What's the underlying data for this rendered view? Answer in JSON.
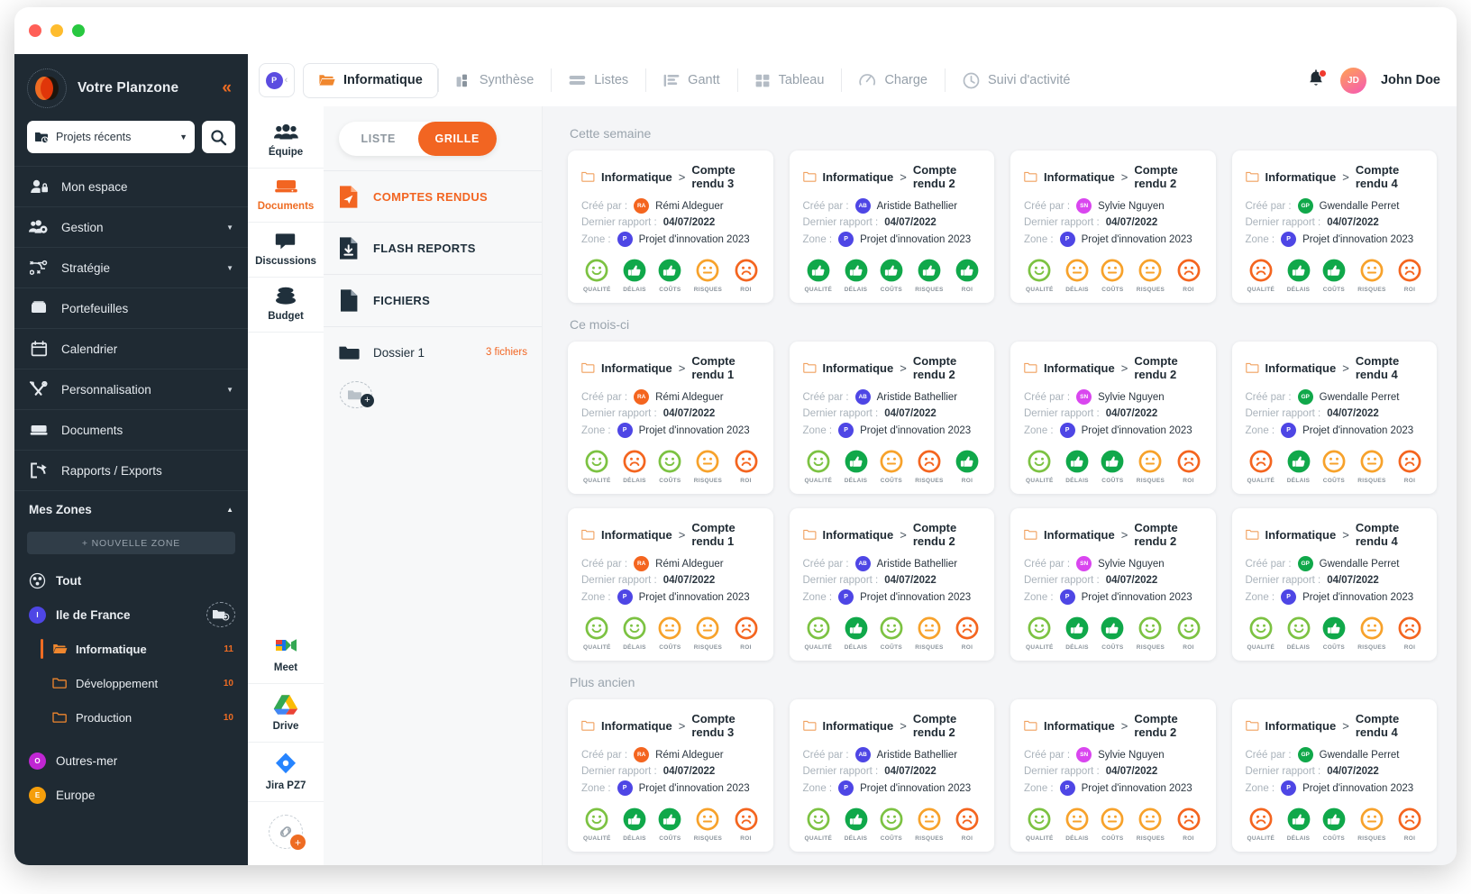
{
  "window": {
    "title": "Planzone"
  },
  "sidebar": {
    "brand": "Votre Planzone",
    "collapse_icon": "double-chevron-left-icon",
    "project_select": {
      "value": "Projets récents",
      "icon": "folder-clock-icon"
    },
    "search_icon": "search-icon",
    "nav": [
      {
        "label": "Mon espace",
        "icon": "user-lock-icon",
        "expandable": false
      },
      {
        "label": "Gestion",
        "icon": "users-gear-icon",
        "expandable": true
      },
      {
        "label": "Stratégie",
        "icon": "strategy-icon",
        "expandable": true
      },
      {
        "label": "Portefeuilles",
        "icon": "portfolio-icon",
        "expandable": false
      },
      {
        "label": "Calendrier",
        "icon": "calendar-icon",
        "expandable": false
      },
      {
        "label": "Personnalisation",
        "icon": "tools-icon",
        "expandable": true
      },
      {
        "label": "Documents",
        "icon": "documents-icon",
        "expandable": false
      },
      {
        "label": "Rapports / Exports",
        "icon": "export-icon",
        "expandable": false
      }
    ],
    "zones_header": "Mes Zones",
    "new_zone_label": "+ NOUVELLE ZONE",
    "zones": [
      {
        "label": "Tout",
        "badge": "",
        "badge_color": "",
        "icon": "all-zones-icon",
        "type": "all"
      },
      {
        "label": "Ile de France",
        "badge": "I",
        "badge_color": "#4e46e5",
        "type": "zone",
        "has_add": true
      },
      {
        "label": "Informatique",
        "count": "11",
        "type": "sub",
        "active": true
      },
      {
        "label": "Développement",
        "count": "10",
        "type": "sub",
        "active": false
      },
      {
        "label": "Production",
        "count": "10",
        "type": "sub",
        "active": false
      },
      {
        "label": "Outres-mer",
        "badge": "O",
        "badge_color": "#c026d3",
        "type": "zone"
      },
      {
        "label": "Europe",
        "badge": "E",
        "badge_color": "#f59e0b",
        "type": "zone"
      }
    ]
  },
  "topbar": {
    "project_badge": "P",
    "active_tab": {
      "label": "Informatique",
      "icon": "folder-open-icon"
    },
    "tabs": [
      {
        "label": "Synthèse",
        "icon": "synthesis-icon"
      },
      {
        "label": "Listes",
        "icon": "lists-icon"
      },
      {
        "label": "Gantt",
        "icon": "gantt-icon"
      },
      {
        "label": "Tableau",
        "icon": "board-icon"
      },
      {
        "label": "Charge",
        "icon": "gauge-icon"
      },
      {
        "label": "Suivi d'activité",
        "icon": "clock-icon"
      }
    ],
    "notification_icon": "bell-icon",
    "user": {
      "initials": "JD",
      "name": "John Doe"
    }
  },
  "rail": {
    "items": [
      {
        "label": "Équipe",
        "icon": "team-icon",
        "active": false
      },
      {
        "label": "Documents",
        "icon": "documents-box-icon",
        "active": true
      },
      {
        "label": "Discussions",
        "icon": "chat-icon",
        "active": false
      },
      {
        "label": "Budget",
        "icon": "coins-icon",
        "active": false
      }
    ],
    "apps": [
      {
        "label": "Meet",
        "icon": "google-meet-icon"
      },
      {
        "label": "Drive",
        "icon": "google-drive-icon"
      },
      {
        "label": "Jira PZ7",
        "icon": "jira-icon"
      }
    ],
    "add_link_icon": "link-add-icon"
  },
  "docpanel": {
    "view_toggle": {
      "list_label": "LISTE",
      "grid_label": "GRILLE",
      "selected": "GRILLE"
    },
    "items": [
      {
        "label": "COMPTES RENDUS",
        "icon": "report-send-icon",
        "active": true
      },
      {
        "label": "FLASH REPORTS",
        "icon": "report-download-icon",
        "active": false
      },
      {
        "label": "FICHIERS",
        "icon": "file-icon",
        "active": false
      }
    ],
    "folders": [
      {
        "label": "Dossier 1",
        "count": "3 fichiers",
        "icon": "folder-icon"
      }
    ],
    "add_folder_icon": "folder-add-icon"
  },
  "kpi_labels": [
    "QUALITÉ",
    "DÉLAIS",
    "COÛTS",
    "RISQUES",
    "ROI"
  ],
  "kpi_colors": {
    "green_light": "#7cc242",
    "green": "#10a84a",
    "orange": "#f7a22b",
    "red": "#f4651f"
  },
  "card_labels": {
    "created_by": "Créé par :",
    "last_report": "Dernier rapport :",
    "zone": "Zone :"
  },
  "people": {
    "remi": {
      "name": "Rémi Aldeguer",
      "initials": "RA",
      "color": "#f4651f"
    },
    "aristide": {
      "name": "Aristide Bathellier",
      "initials": "AB",
      "color": "#4e46e5"
    },
    "sylvie": {
      "name": "Sylvie Nguyen",
      "initials": "SN",
      "color": "#d946ef"
    },
    "gwendalle": {
      "name": "Gwendalle Perret",
      "initials": "GP",
      "color": "#10a84a"
    }
  },
  "sections": [
    {
      "title": "Cette semaine",
      "cards": [
        {
          "breadcrumb": "Informatique",
          "title": "Compte rendu 3",
          "author": "remi",
          "date": "04/07/2022",
          "zone_badge": "P",
          "zone": "Projet d'innovation 2023",
          "kpis": [
            "smile-light",
            "thumb-up",
            "thumb-up",
            "neutral-orange",
            "sad-red"
          ]
        },
        {
          "breadcrumb": "Informatique",
          "title": "Compte rendu 2",
          "author": "aristide",
          "date": "04/07/2022",
          "zone_badge": "P",
          "zone": "Projet d'innovation 2023",
          "kpis": [
            "thumb-up",
            "thumb-up",
            "thumb-up",
            "thumb-up",
            "thumb-up"
          ]
        },
        {
          "breadcrumb": "Informatique",
          "title": "Compte rendu 2",
          "author": "sylvie",
          "date": "04/07/2022",
          "zone_badge": "P",
          "zone": "Projet d'innovation 2023",
          "kpis": [
            "smile-light",
            "neutral-orange",
            "neutral-orange",
            "neutral-orange",
            "sad-red"
          ]
        },
        {
          "breadcrumb": "Informatique",
          "title": "Compte rendu 4",
          "author": "gwendalle",
          "date": "04/07/2022",
          "zone_badge": "P",
          "zone": "Projet d'innovation 2023",
          "kpis": [
            "sad-red",
            "thumb-up",
            "thumb-up",
            "neutral-orange",
            "sad-red"
          ]
        }
      ]
    },
    {
      "title": "Ce mois-ci",
      "cards": [
        {
          "breadcrumb": "Informatique",
          "title": "Compte rendu 1",
          "author": "remi",
          "date": "04/07/2022",
          "zone_badge": "P",
          "zone": "Projet d'innovation 2023",
          "kpis": [
            "smile-light",
            "sad-red",
            "smile-light",
            "neutral-orange",
            "sad-red"
          ]
        },
        {
          "breadcrumb": "Informatique",
          "title": "Compte rendu 2",
          "author": "aristide",
          "date": "04/07/2022",
          "zone_badge": "P",
          "zone": "Projet d'innovation 2023",
          "kpis": [
            "smile-light",
            "thumb-up",
            "neutral-orange",
            "sad-red",
            "thumb-up"
          ]
        },
        {
          "breadcrumb": "Informatique",
          "title": "Compte rendu 2",
          "author": "sylvie",
          "date": "04/07/2022",
          "zone_badge": "P",
          "zone": "Projet d'innovation 2023",
          "kpis": [
            "smile-light",
            "thumb-up",
            "thumb-up",
            "neutral-orange",
            "sad-red"
          ]
        },
        {
          "breadcrumb": "Informatique",
          "title": "Compte rendu 4",
          "author": "gwendalle",
          "date": "04/07/2022",
          "zone_badge": "P",
          "zone": "Projet d'innovation 2023",
          "kpis": [
            "sad-red",
            "thumb-up",
            "neutral-orange",
            "neutral-orange",
            "sad-red"
          ]
        }
      ]
    },
    {
      "title": "",
      "cards": [
        {
          "breadcrumb": "Informatique",
          "title": "Compte rendu 1",
          "author": "remi",
          "date": "04/07/2022",
          "zone_badge": "P",
          "zone": "Projet d'innovation 2023",
          "kpis": [
            "smile-light",
            "smile-light",
            "neutral-orange",
            "neutral-orange",
            "sad-red"
          ]
        },
        {
          "breadcrumb": "Informatique",
          "title": "Compte rendu 2",
          "author": "aristide",
          "date": "04/07/2022",
          "zone_badge": "P",
          "zone": "Projet d'innovation 2023",
          "kpis": [
            "smile-light",
            "thumb-up",
            "smile-light",
            "neutral-orange",
            "sad-red"
          ]
        },
        {
          "breadcrumb": "Informatique",
          "title": "Compte rendu 2",
          "author": "sylvie",
          "date": "04/07/2022",
          "zone_badge": "P",
          "zone": "Projet d'innovation 2023",
          "kpis": [
            "smile-light",
            "thumb-up",
            "thumb-up",
            "smile-light",
            "smile-light"
          ]
        },
        {
          "breadcrumb": "Informatique",
          "title": "Compte rendu 4",
          "author": "gwendalle",
          "date": "04/07/2022",
          "zone_badge": "P",
          "zone": "Projet d'innovation 2023",
          "kpis": [
            "smile-light",
            "smile-light",
            "thumb-up",
            "neutral-orange",
            "sad-red"
          ]
        }
      ]
    },
    {
      "title": "Plus ancien",
      "cards": [
        {
          "breadcrumb": "Informatique",
          "title": "Compte rendu 3",
          "author": "remi",
          "date": "04/07/2022",
          "zone_badge": "P",
          "zone": "Projet d'innovation 2023",
          "kpis": [
            "smile-light",
            "thumb-up",
            "thumb-up",
            "neutral-orange",
            "sad-red"
          ]
        },
        {
          "breadcrumb": "Informatique",
          "title": "Compte rendu 2",
          "author": "aristide",
          "date": "04/07/2022",
          "zone_badge": "P",
          "zone": "Projet d'innovation 2023",
          "kpis": [
            "smile-light",
            "thumb-up",
            "smile-light",
            "neutral-orange",
            "sad-red"
          ]
        },
        {
          "breadcrumb": "Informatique",
          "title": "Compte rendu 2",
          "author": "sylvie",
          "date": "04/07/2022",
          "zone_badge": "P",
          "zone": "Projet d'innovation 2023",
          "kpis": [
            "smile-light",
            "neutral-orange",
            "neutral-orange",
            "neutral-orange",
            "sad-red"
          ]
        },
        {
          "breadcrumb": "Informatique",
          "title": "Compte rendu 4",
          "author": "gwendalle",
          "date": "04/07/2022",
          "zone_badge": "P",
          "zone": "Projet d'innovation 2023",
          "kpis": [
            "sad-red",
            "thumb-up",
            "thumb-up",
            "neutral-orange",
            "sad-red"
          ]
        }
      ]
    }
  ]
}
